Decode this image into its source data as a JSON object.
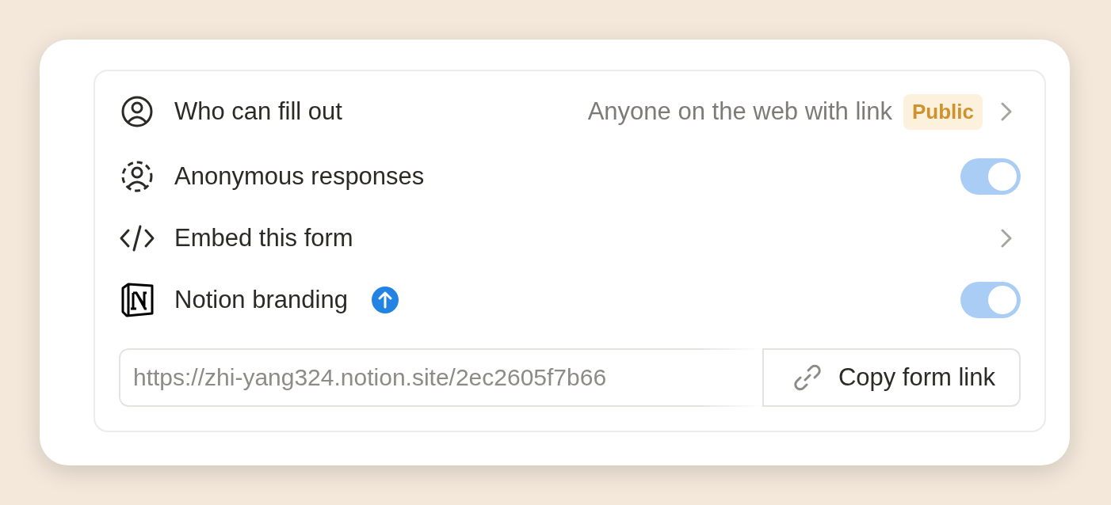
{
  "rows": [
    {
      "kind": "choice",
      "label": "Who can fill out",
      "value": "Anyone on the web with link",
      "badge": "Public"
    },
    {
      "kind": "toggle",
      "label": "Anonymous responses",
      "on": true
    },
    {
      "kind": "link",
      "label": "Embed this form"
    },
    {
      "kind": "toggle",
      "label": "Notion branding",
      "upgrade": true,
      "on": true
    }
  ],
  "link_field": {
    "value": "https://zhi-yang324.notion.site/2ec2605f7b66"
  },
  "copy_button": {
    "label": "Copy form link"
  }
}
